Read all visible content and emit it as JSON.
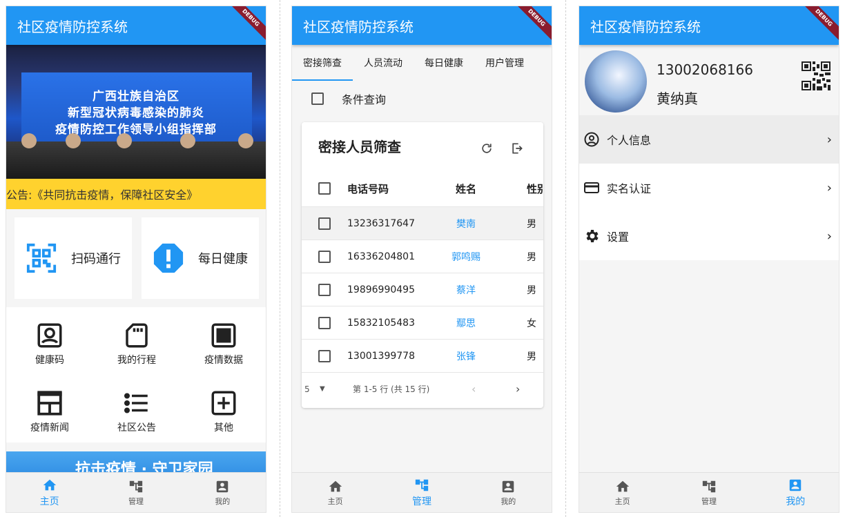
{
  "app_title": "社区疫情防控系统",
  "debug_label": "DEBUG",
  "nav": {
    "home": "主页",
    "manage": "管理",
    "mine": "我的"
  },
  "home": {
    "banner_lines": [
      "广西壮族自治区",
      "新型冠状病毒感染的肺炎",
      "疫情防控工作领导小组指挥部"
    ],
    "notice": "公告:《共同抗击疫情，保障社区安全》",
    "quick": [
      {
        "label": "扫码通行",
        "icon": "qr-scan-icon"
      },
      {
        "label": "每日健康",
        "icon": "alert-octagon-icon"
      }
    ],
    "grid": [
      "健康码",
      "我的行程",
      "疫情数据",
      "疫情新闻",
      "社区公告",
      "其他"
    ],
    "ad_text": "抗击疫情 · 守卫家园"
  },
  "manage": {
    "tabs": [
      "密接筛查",
      "人员流动",
      "每日健康",
      "用户管理"
    ],
    "condition": "条件查询",
    "card_title": "密接人员筛查",
    "columns": [
      "电话号码",
      "姓名",
      "性别"
    ],
    "rows": [
      {
        "phone": "13236317647",
        "name": "樊南",
        "gender": "男"
      },
      {
        "phone": "16336204801",
        "name": "郭鸣赐",
        "gender": "男"
      },
      {
        "phone": "19896990495",
        "name": "蔡洋",
        "gender": "男"
      },
      {
        "phone": "15832105483",
        "name": "鄢思",
        "gender": "女"
      },
      {
        "phone": "13001399778",
        "name": "张锋",
        "gender": "男"
      }
    ],
    "page_size": "5",
    "page_info": "第 1-5 行 (共 15 行)"
  },
  "mine": {
    "phone": "13002068166",
    "name": "黄纳真",
    "menu": [
      {
        "label": "个人信息",
        "icon": "account-circle-icon"
      },
      {
        "label": "实名认证",
        "icon": "credit-card-icon"
      },
      {
        "label": "设置",
        "icon": "gear-icon"
      }
    ]
  },
  "colors": {
    "primary": "#2196F3",
    "notice_bg": "#FFD22E",
    "debug_banner": "#8A1C2E"
  }
}
